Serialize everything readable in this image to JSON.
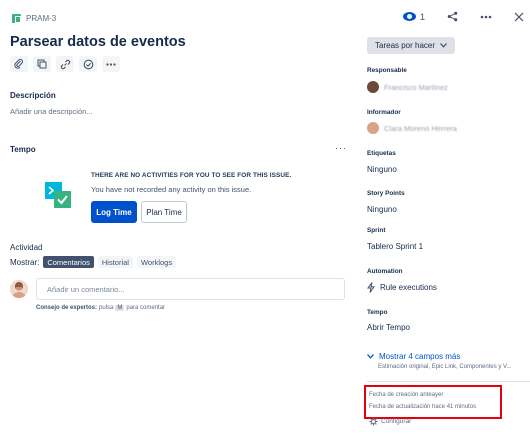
{
  "issue": {
    "key": "PRAM-3",
    "title": "Parsear datos de eventos",
    "watchers_count": "1"
  },
  "toolbar": {
    "icons": [
      "attach-icon",
      "child-issue-icon",
      "link-icon",
      "checklist-icon",
      "more-icon"
    ]
  },
  "description": {
    "label": "Descripción",
    "placeholder": "Añadir una descripción..."
  },
  "tempo": {
    "label": "Tempo",
    "more": "···",
    "heading": "THERE ARE NO ACTIVITIES FOR YOU TO SEE FOR THIS ISSUE.",
    "subtext": "You have not recorded any activity on this issue.",
    "log_time_label": "Log Time",
    "plan_time_label": "Plan Time"
  },
  "activity": {
    "label": "Actividad",
    "show_label": "Mostrar:",
    "filters": [
      {
        "label": "Comentarios",
        "active": true
      },
      {
        "label": "Historial",
        "active": false
      },
      {
        "label": "Worklogs",
        "active": false
      }
    ],
    "comment_placeholder": "Añadir un comentario...",
    "tip_bold": "Consejo de expertos:",
    "tip_press": "pulsa",
    "tip_key": "M",
    "tip_rest": "para comentar"
  },
  "sidebar": {
    "status_label": "Tareas por hacer",
    "assignee_label": "Responsable",
    "assignee_name": "Francisco Martínez",
    "reporter_label": "Informador",
    "reporter_name": "Clara Moreno Herrera",
    "labels_label": "Etiquetas",
    "labels_value": "Ninguno",
    "story_points_label": "Story Points",
    "story_points_value": "Ninguno",
    "sprint_label": "Sprint",
    "sprint_value": "Tablero Sprint 1",
    "automation_label": "Automation",
    "automation_value": "Rule executions",
    "tempo_label": "Tempo",
    "tempo_value": "Abrir Tempo",
    "more_fields_label": "Mostrar 4 campos más",
    "more_fields_sub": "Estimación original, Epic Link, Componentes y V...",
    "created": "Fecha de creación anteayer",
    "updated": "Fecha de actualización hace 41 minutos",
    "configure_label": "Configurar"
  },
  "colors": {
    "primary": "#0052cc",
    "story_icon": "#36b37e",
    "highlight": "#e3000f"
  }
}
